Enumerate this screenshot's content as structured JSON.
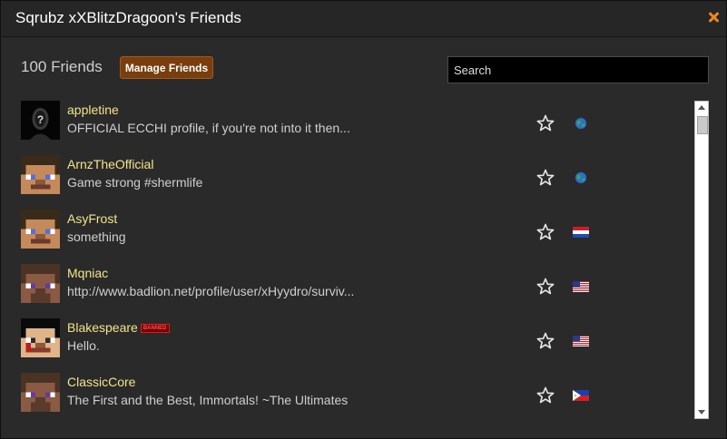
{
  "header": {
    "title": "Sqrubz xXBlitzDragoon's Friends"
  },
  "toolbar": {
    "friend_count": "100 Friends",
    "manage_label": "Manage Friends"
  },
  "search": {
    "placeholder": "Search"
  },
  "colors": {
    "accent": "#e8862a",
    "name": "#f2e48a",
    "button": "#7a3e0e"
  },
  "friends": [
    {
      "name": "appletine",
      "status": "OFFICIAL ECCHI profile, if you're not into it then...",
      "badge": "",
      "flag": "globe",
      "avatar": "question"
    },
    {
      "name": "ArnzTheOfficial",
      "status": "Game strong #shermlife",
      "badge": "",
      "flag": "globe",
      "avatar": "steve"
    },
    {
      "name": "AsyFrost",
      "status": "something",
      "badge": "",
      "flag": "netherlands",
      "avatar": "steve"
    },
    {
      "name": "Mqniac",
      "status": "http://www.badlion.net/profile/user/xHyydro/surviv...",
      "badge": "",
      "flag": "usa",
      "avatar": "brown"
    },
    {
      "name": "Blakespeare",
      "status": "Hello.",
      "badge": "BANNED",
      "flag": "usa",
      "avatar": "dark"
    },
    {
      "name": "ClassicCore",
      "status": "The First and the Best, Immortals! ~The Ultimates",
      "badge": "",
      "flag": "philippines",
      "avatar": "brown"
    }
  ]
}
